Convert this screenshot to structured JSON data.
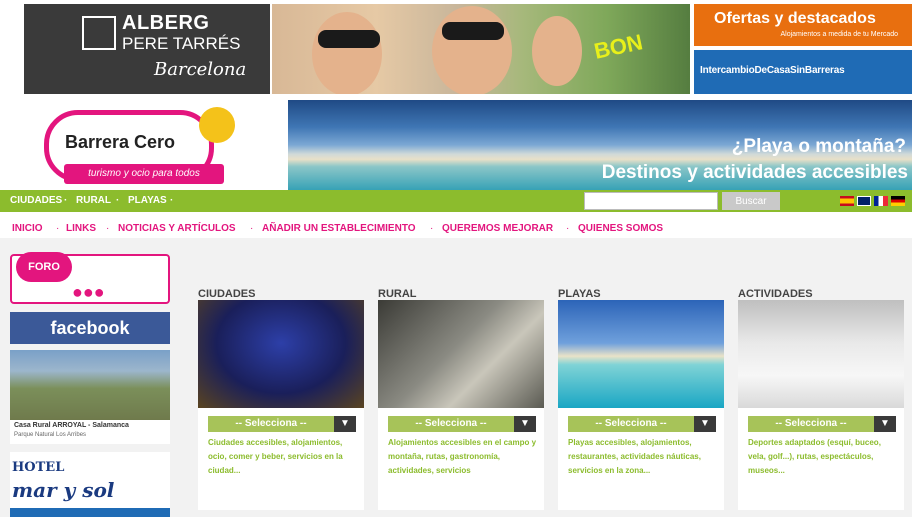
{
  "top_ads": {
    "alberg": {
      "line1": "ALBERG",
      "line2": "PERE TARRÉS",
      "line3": "Barcelona"
    },
    "bon": {
      "text": "BON"
    },
    "offers": {
      "title": "Ofertas y destacados",
      "subtitle": "Alojamientos a medida de tu Mercado"
    },
    "exchange": {
      "title": "IntercambioDeCasaSinBarreras"
    }
  },
  "logo": {
    "title": "Barrera Cero",
    "tagline": "turismo y ocio para todos"
  },
  "banner": {
    "question": "¿Playa o montaña?",
    "subtitle": "Destinos y actividades accesibles"
  },
  "green_nav": {
    "items": [
      "CIUDADES",
      "RURAL",
      "PLAYAS"
    ],
    "separator": "·"
  },
  "search": {
    "placeholder": "",
    "button": "Buscar"
  },
  "flags": [
    "es",
    "gb",
    "fr",
    "de"
  ],
  "pink_nav": {
    "items": [
      "INICIO",
      "LINKS",
      "NOTICIAS Y ARTÍCULOS",
      "AÑADIR UN ESTABLECIMIENTO",
      "QUEREMOS MEJORAR",
      "QUIENES SOMOS"
    ]
  },
  "sidebar": {
    "foro": "FORO",
    "facebook": "facebook",
    "arroyal": {
      "title": "Casa Rural ARROYAL - Salamanca",
      "subtitle": "Parque Natural Los Arribes"
    },
    "marysol": {
      "line1": "HOTEL",
      "line2": "mar y sol"
    }
  },
  "categories": [
    {
      "title": "CIUDADES",
      "select": "-- Selecciona --",
      "desc": "Ciudades accesibles, alojamientos, ocio, comer y beber, servicios en la ciudad..."
    },
    {
      "title": "RURAL",
      "select": "-- Selecciona --",
      "desc": "Alojamientos accesibles en el campo y montaña, rutas, gastronomía, actividades, servicios"
    },
    {
      "title": "PLAYAS",
      "select": "-- Selecciona --",
      "desc": "Playas accesibles, alojamientos, restaurantes, actividades náuticas, servicios en la zona..."
    },
    {
      "title": "ACTIVIDADES",
      "select": "-- Selecciona --",
      "desc": "Deportes adaptados (esquí, buceo, vela, golf...), rutas, espectáculos, museos..."
    }
  ],
  "colors": {
    "green": "#8cbc2d",
    "pink": "#e3157e",
    "orange": "#e86f0f",
    "blue": "#1f6bb5",
    "facebook": "#3b5998"
  }
}
